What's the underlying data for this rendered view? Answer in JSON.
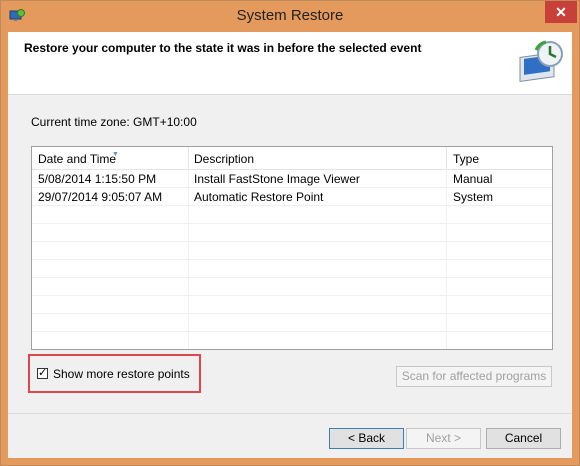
{
  "window": {
    "title": "System Restore",
    "close_symbol": "✕"
  },
  "header": {
    "title": "Restore your computer to the state it was in before the selected event"
  },
  "timezone_label": "Current time zone: GMT+10:00",
  "table": {
    "columns": [
      "Date and Time",
      "Description",
      "Type"
    ],
    "rows": [
      {
        "date": "5/08/2014 1:15:50 PM",
        "description": "Install FastStone Image Viewer",
        "type": "Manual"
      },
      {
        "date": "29/07/2014 9:05:07 AM",
        "description": "Automatic Restore Point",
        "type": "System"
      }
    ]
  },
  "show_more": {
    "label": "Show more restore points",
    "checked": true
  },
  "buttons": {
    "scan": "Scan for affected programs",
    "back": "< Back",
    "next": "Next >",
    "cancel": "Cancel"
  },
  "icons": [
    "system-restore-icon",
    "system-restore-header-icon",
    "close-icon",
    "sort-arrow-icon",
    "checkmark-icon"
  ],
  "colors": {
    "titlebar": "#e59a5d",
    "close": "#c7403a",
    "highlight_box": "#e0474c"
  }
}
